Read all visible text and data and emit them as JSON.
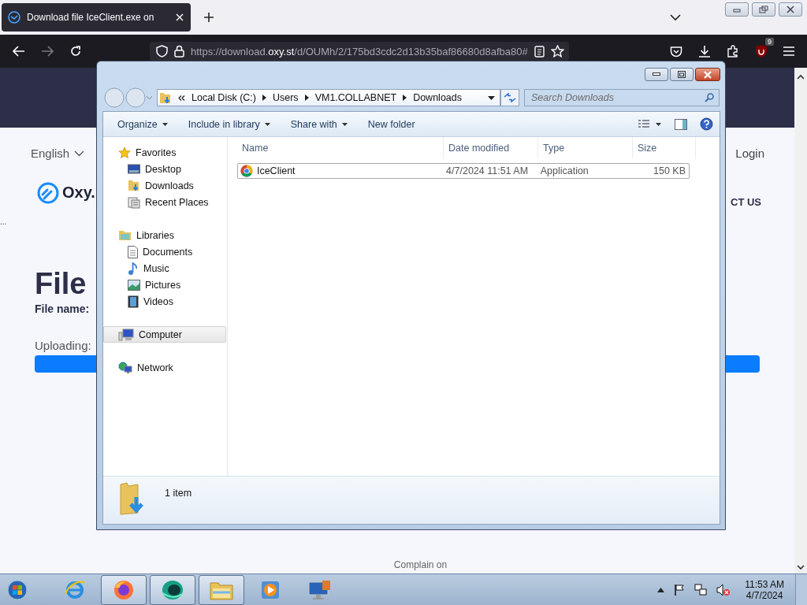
{
  "browser": {
    "tab": {
      "title": "Download file IceClient.exe on",
      "selected": true
    },
    "url": {
      "prefix": "https://download.",
      "domain": "oxy.st",
      "path": "/d/OUMh/2/175bd3cdc2d13b35baf86680d8afba80#"
    },
    "extension_badge": "9"
  },
  "webpage": {
    "language": "English",
    "login": "Login",
    "logo": "Oxy.",
    "nav_link": "CT US",
    "ellipsis": "...",
    "heading": "File",
    "file_name_label": "File name:",
    "uploading_label": "Uploading:",
    "upload_bar": {
      "level": 1
    },
    "footer": "Complain on"
  },
  "explorer": {
    "breadcrumb": [
      "Local Disk (C:)",
      "Users",
      "VM1.COLLABNET",
      "Downloads"
    ],
    "search_placeholder": "Search Downloads",
    "toolbar": [
      {
        "label": "Organize",
        "dropdown": true
      },
      {
        "label": "Include in library",
        "dropdown": true
      },
      {
        "label": "Share with",
        "dropdown": true
      },
      {
        "label": "New folder",
        "dropdown": false
      }
    ],
    "nav": [
      {
        "label": "Favorites",
        "kind": "star",
        "selected": false,
        "children": [
          {
            "label": "Desktop",
            "kind": "desktop",
            "selected": false
          },
          {
            "label": "Downloads",
            "kind": "downloads",
            "selected": false
          },
          {
            "label": "Recent Places",
            "kind": "recent",
            "selected": false
          }
        ]
      },
      {
        "label": "Libraries",
        "kind": "library",
        "selected": false,
        "children": [
          {
            "label": "Documents",
            "kind": "document",
            "selected": false
          },
          {
            "label": "Music",
            "kind": "music",
            "selected": false
          },
          {
            "label": "Pictures",
            "kind": "pictures",
            "selected": false
          },
          {
            "label": "Videos",
            "kind": "videos",
            "selected": false
          }
        ]
      },
      {
        "label": "Computer",
        "kind": "computer",
        "selected": true
      },
      {
        "label": "Network",
        "kind": "network",
        "selected": false
      }
    ],
    "columns": [
      "Name",
      "Date modified",
      "Type",
      "Size"
    ],
    "files": [
      {
        "name": "IceClient",
        "date": "4/7/2024 11:51 AM",
        "type": "Application",
        "size": "150 KB",
        "focused": true
      }
    ],
    "status": "1 item"
  },
  "taskbar": {
    "items": [
      {
        "kind": "ie",
        "active": false
      },
      {
        "kind": "firefox",
        "active": true
      },
      {
        "kind": "app",
        "active": true
      },
      {
        "kind": "explorer",
        "active": true
      },
      {
        "kind": "media",
        "active": false
      },
      {
        "kind": "remote",
        "active": false
      }
    ],
    "time": "11:53 AM",
    "date": "4/7/2024"
  }
}
